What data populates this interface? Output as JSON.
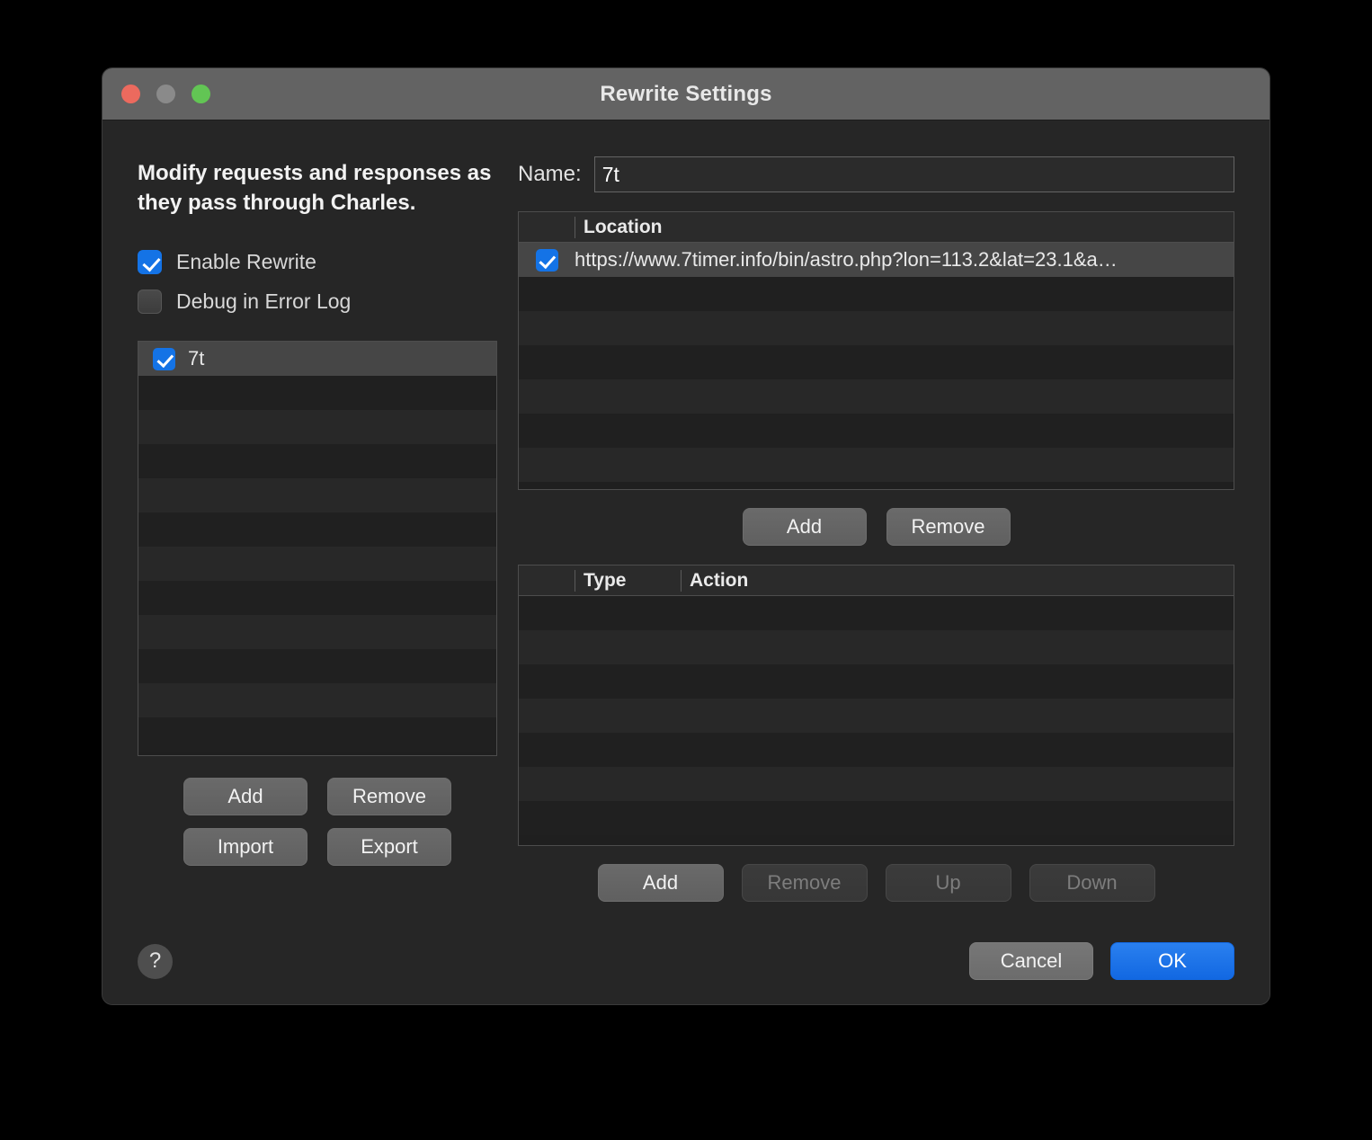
{
  "window": {
    "title": "Rewrite Settings",
    "traffic_lights": [
      {
        "name": "close-button",
        "color": "#ec6a5e"
      },
      {
        "name": "minimize-button",
        "color": "#8a8a8a"
      },
      {
        "name": "maximize-button",
        "color": "#62c554"
      }
    ]
  },
  "left": {
    "description": "Modify requests and responses as they pass through Charles.",
    "options": [
      {
        "label": "Enable Rewrite",
        "checked": true
      },
      {
        "label": "Debug in Error Log",
        "checked": false
      }
    ],
    "sets": [
      {
        "label": "7t",
        "checked": true,
        "selected": true
      }
    ],
    "buttons": {
      "add": "Add",
      "remove": "Remove",
      "import": "Import",
      "export": "Export"
    }
  },
  "right": {
    "name_label": "Name:",
    "name_value": "7t",
    "name_placeholder": "",
    "locations": {
      "header": "Location",
      "rows": [
        {
          "checked": true,
          "value": "https://www.7timer.info/bin/astro.php?lon=113.2&lat=23.1&a…",
          "selected": true
        }
      ],
      "buttons": {
        "add": "Add",
        "remove": "Remove"
      }
    },
    "rules": {
      "headers": {
        "type": "Type",
        "action": "Action"
      },
      "rows": [],
      "buttons": {
        "add": {
          "label": "Add",
          "enabled": true
        },
        "remove": {
          "label": "Remove",
          "enabled": false
        },
        "up": {
          "label": "Up",
          "enabled": false
        },
        "down": {
          "label": "Down",
          "enabled": false
        }
      }
    }
  },
  "footer": {
    "help": "?",
    "cancel": "Cancel",
    "ok": "OK"
  },
  "colors": {
    "accent": "#1473e6",
    "primary_button": "#1268e2",
    "window_chrome": "#636363",
    "window_body": "#262626"
  }
}
